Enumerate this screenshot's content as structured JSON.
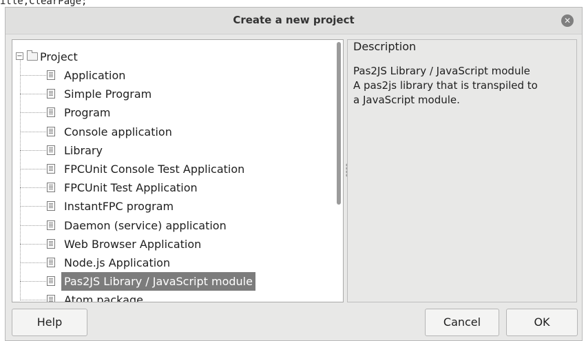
{
  "background": {
    "code_text": "itle,ClearPage;"
  },
  "dialog": {
    "title": "Create a new project",
    "close_icon": "close-icon",
    "tree": {
      "root": {
        "label": "Project",
        "expanded": true,
        "icon": "folder-icon"
      },
      "items": [
        {
          "label": "Application"
        },
        {
          "label": "Simple Program"
        },
        {
          "label": "Program"
        },
        {
          "label": "Console application"
        },
        {
          "label": "Library"
        },
        {
          "label": "FPCUnit Console Test Application"
        },
        {
          "label": "FPCUnit Test Application"
        },
        {
          "label": "InstantFPC program"
        },
        {
          "label": "Daemon (service) application"
        },
        {
          "label": "Web Browser Application"
        },
        {
          "label": "Node.js Application"
        },
        {
          "label": "Pas2JS Library / JavaScript module",
          "selected": true
        },
        {
          "label": "Atom package"
        }
      ]
    },
    "description": {
      "legend": "Description",
      "lines": [
        "Pas2JS Library / JavaScript module",
        "A pas2js library that is transpiled to",
        "a JavaScript module."
      ]
    },
    "buttons": {
      "help": "Help",
      "cancel": "Cancel",
      "ok": "OK"
    },
    "colors": {
      "selection": "#7c7c7c",
      "dialog_bg": "#e8e8e7"
    }
  }
}
